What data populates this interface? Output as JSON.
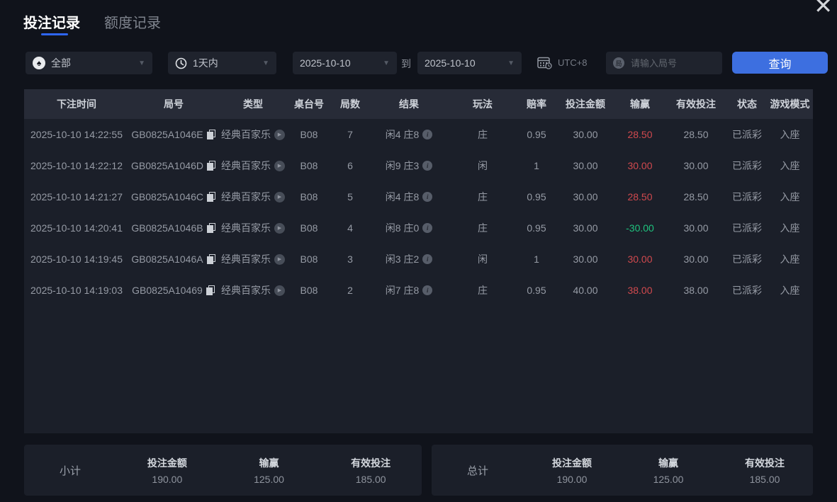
{
  "window": {
    "close_icon": "✕"
  },
  "tabs": [
    {
      "label": "投注记录",
      "active": true
    },
    {
      "label": "额度记录",
      "active": false
    }
  ],
  "filters": {
    "game_type": {
      "value": "全部",
      "icon": "spade-icon"
    },
    "time_range": {
      "value": "1天内",
      "icon": "clock-icon"
    },
    "date_from": "2025-10-10",
    "date_to": "2025-10-10",
    "to_label": "到",
    "timezone": "UTC+8",
    "round_input": {
      "placeholder": "请输入局号",
      "value": "",
      "icon": "局"
    },
    "search_button": "查询"
  },
  "table": {
    "headers": [
      "下注时间",
      "局号",
      "类型",
      "桌台号",
      "局数",
      "结果",
      "玩法",
      "赔率",
      "投注金额",
      "输赢",
      "有效投注",
      "状态",
      "游戏模式"
    ],
    "rows": [
      {
        "time": "2025-10-10 14:22:55",
        "round_id": "GB0825A1046E",
        "type": "经典百家乐",
        "table_no": "B08",
        "round_no": "7",
        "result": "闲4 庄8",
        "play": "庄",
        "odds": "0.95",
        "amount": "30.00",
        "win_loss": "28.50",
        "valid": "28.50",
        "status": "已派彩",
        "mode": "入座"
      },
      {
        "time": "2025-10-10 14:22:12",
        "round_id": "GB0825A1046D",
        "type": "经典百家乐",
        "table_no": "B08",
        "round_no": "6",
        "result": "闲9 庄3",
        "play": "闲",
        "odds": "1",
        "amount": "30.00",
        "win_loss": "30.00",
        "valid": "30.00",
        "status": "已派彩",
        "mode": "入座"
      },
      {
        "time": "2025-10-10 14:21:27",
        "round_id": "GB0825A1046C",
        "type": "经典百家乐",
        "table_no": "B08",
        "round_no": "5",
        "result": "闲4 庄8",
        "play": "庄",
        "odds": "0.95",
        "amount": "30.00",
        "win_loss": "28.50",
        "valid": "28.50",
        "status": "已派彩",
        "mode": "入座"
      },
      {
        "time": "2025-10-10 14:20:41",
        "round_id": "GB0825A1046B",
        "type": "经典百家乐",
        "table_no": "B08",
        "round_no": "4",
        "result": "闲8 庄0",
        "play": "庄",
        "odds": "0.95",
        "amount": "30.00",
        "win_loss": "-30.00",
        "valid": "30.00",
        "status": "已派彩",
        "mode": "入座"
      },
      {
        "time": "2025-10-10 14:19:45",
        "round_id": "GB0825A1046A",
        "type": "经典百家乐",
        "table_no": "B08",
        "round_no": "3",
        "result": "闲3 庄2",
        "play": "闲",
        "odds": "1",
        "amount": "30.00",
        "win_loss": "30.00",
        "valid": "30.00",
        "status": "已派彩",
        "mode": "入座"
      },
      {
        "time": "2025-10-10 14:19:03",
        "round_id": "GB0825A10469",
        "type": "经典百家乐",
        "table_no": "B08",
        "round_no": "2",
        "result": "闲7 庄8",
        "play": "庄",
        "odds": "0.95",
        "amount": "40.00",
        "win_loss": "38.00",
        "valid": "38.00",
        "status": "已派彩",
        "mode": "入座"
      }
    ]
  },
  "summary": {
    "subtotal": {
      "label": "小计",
      "amount_label": "投注金额",
      "amount": "190.00",
      "win_label": "输赢",
      "win": "125.00",
      "valid_label": "有效投注",
      "valid": "185.00"
    },
    "total": {
      "label": "总计",
      "amount_label": "投注金额",
      "amount": "190.00",
      "win_label": "输赢",
      "win": "125.00",
      "valid_label": "有效投注",
      "valid": "185.00"
    }
  },
  "colors": {
    "accent_blue": "#3d6fe0",
    "win_red": "#d0494e",
    "loss_green": "#1ec37e",
    "tab_underline": "#2e66f4"
  }
}
